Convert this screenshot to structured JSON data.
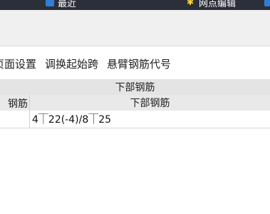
{
  "topbar": {
    "item1_label": "最近",
    "item2_label": "网点编辑"
  },
  "toolbar": {
    "page_setup": "页面设置",
    "swap_start_span": "调换起始跨",
    "cantilever_rebar_code": "悬臂钢筋代号"
  },
  "table": {
    "group_header": "下部钢筋",
    "left_column_header": "钢筋",
    "right_column_header": "下部钢筋",
    "rows": [
      {
        "left": "",
        "right": "4⏉22(-4)/8⏉25"
      }
    ]
  }
}
